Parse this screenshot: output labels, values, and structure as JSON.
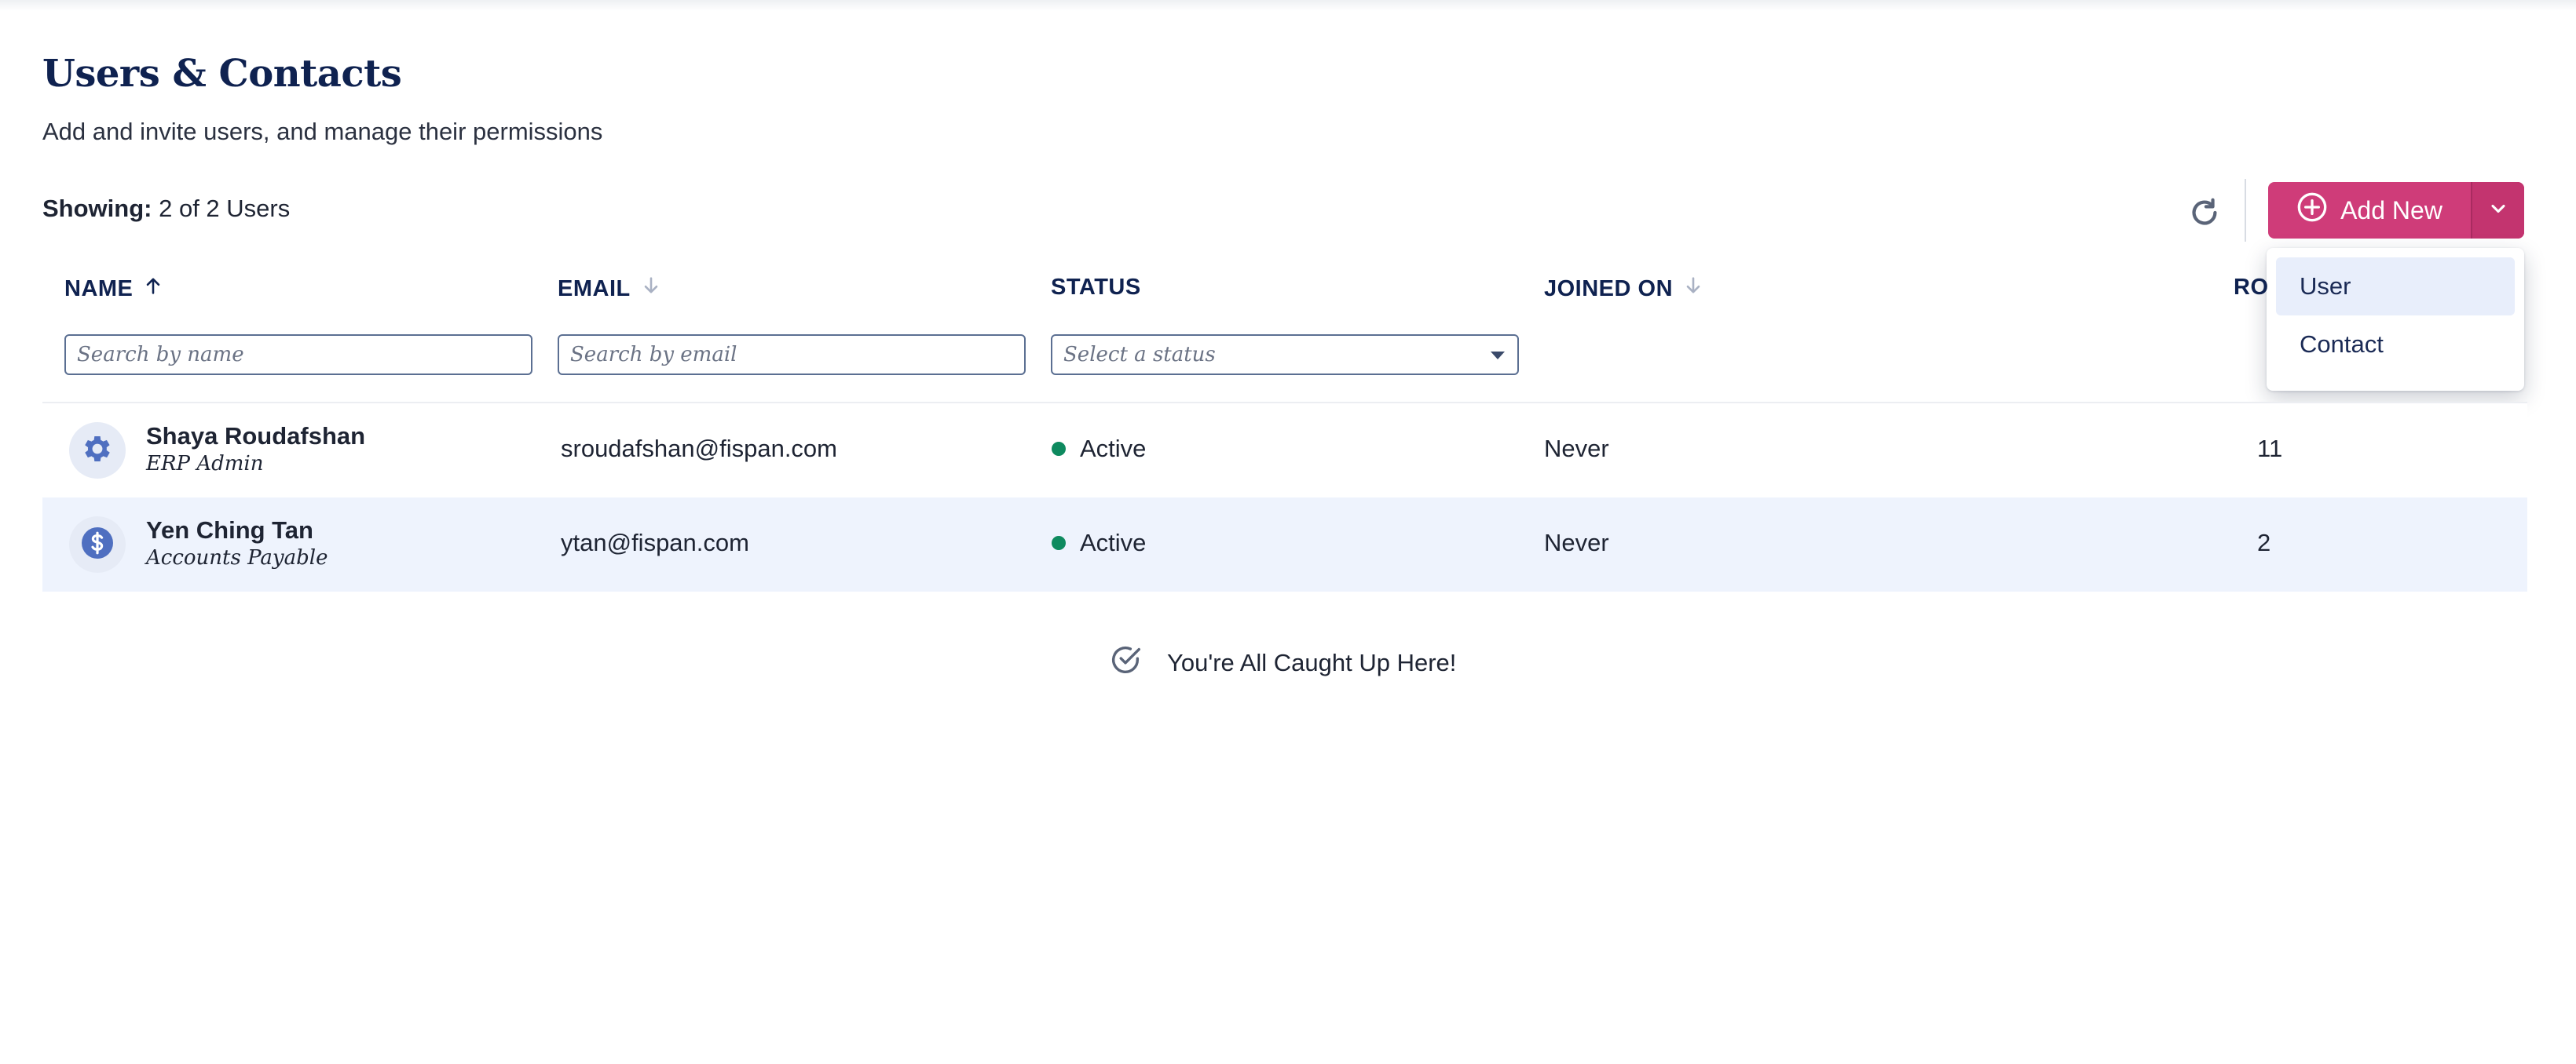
{
  "page": {
    "title": "Users & Contacts",
    "subtitle": "Add and invite users, and manage their permissions"
  },
  "toolbar": {
    "showing_label": "Showing:",
    "showing_value": "2 of 2 Users",
    "add_new_label": "Add New",
    "dropdown_items": [
      "User",
      "Contact"
    ],
    "accent_color": "#cf3c79"
  },
  "table": {
    "columns": [
      {
        "label": "NAME",
        "sort": "ascending"
      },
      {
        "label": "EMAIL",
        "sort": "descending"
      },
      {
        "label": "STATUS",
        "sort": "none"
      },
      {
        "label": "JOINED ON",
        "sort": "descending"
      },
      {
        "label": "RO",
        "sort": "none"
      }
    ],
    "filters": {
      "name_placeholder": "Search by name",
      "email_placeholder": "Search by email",
      "status_placeholder": "Select a status"
    },
    "rows": [
      {
        "name": "Shaya Roudafshan",
        "role": "ERP Admin",
        "email": "sroudafshan@fispan.com",
        "status": "Active",
        "joined": "Never",
        "roles_count": "11",
        "icon": "gear-icon"
      },
      {
        "name": "Yen Ching Tan",
        "role": "Accounts Payable",
        "email": "ytan@fispan.com",
        "status": "Active",
        "joined": "Never",
        "roles_count": "2",
        "icon": "dollar-icon"
      }
    ],
    "status_color": "#0e8a5f"
  },
  "empty_state": {
    "message": "You're All Caught Up Here!"
  }
}
